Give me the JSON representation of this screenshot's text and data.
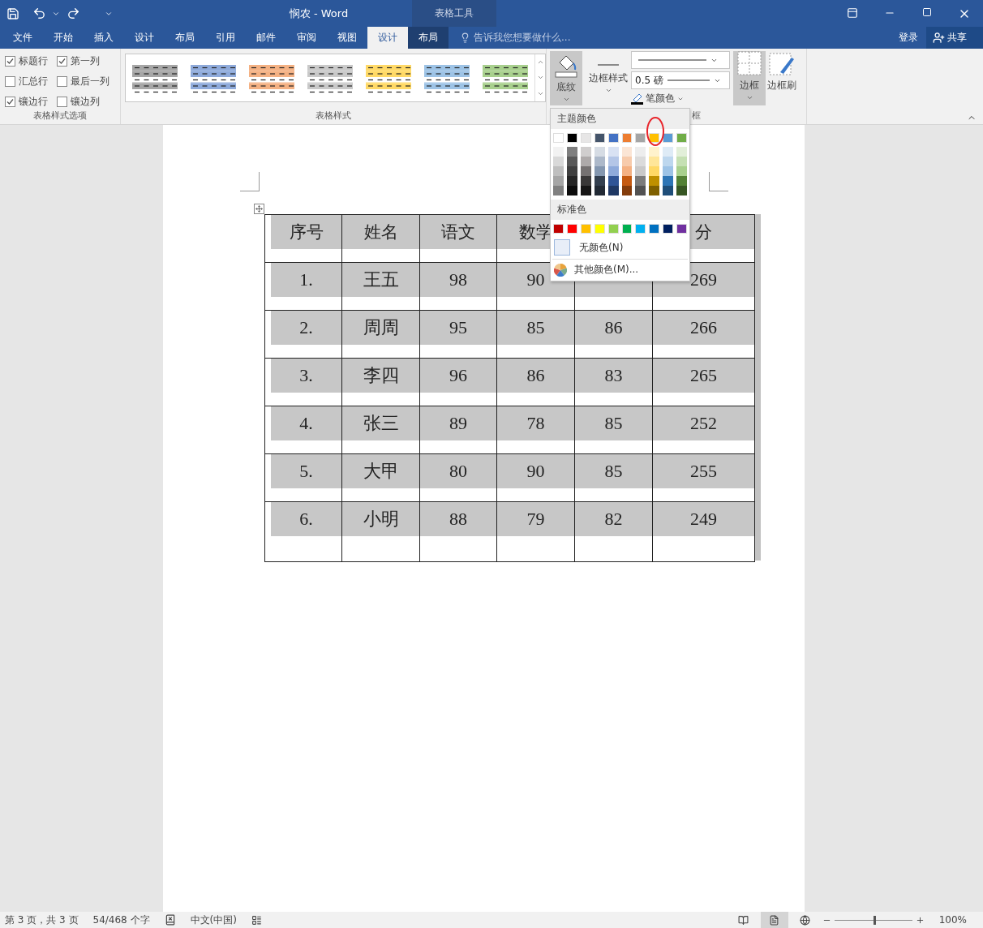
{
  "window": {
    "title": "悯农 - Word",
    "context_header": "表格工具"
  },
  "tabs": [
    {
      "label": "文件",
      "selected": false,
      "contextual": false
    },
    {
      "label": "开始",
      "selected": false,
      "contextual": false
    },
    {
      "label": "插入",
      "selected": false,
      "contextual": false
    },
    {
      "label": "设计",
      "selected": false,
      "contextual": false
    },
    {
      "label": "布局",
      "selected": false,
      "contextual": false
    },
    {
      "label": "引用",
      "selected": false,
      "contextual": false
    },
    {
      "label": "邮件",
      "selected": false,
      "contextual": false
    },
    {
      "label": "审阅",
      "selected": false,
      "contextual": false
    },
    {
      "label": "视图",
      "selected": false,
      "contextual": false
    },
    {
      "label": "设计",
      "selected": true,
      "contextual": true
    },
    {
      "label": "布局",
      "selected": false,
      "contextual": true
    }
  ],
  "tell_me": {
    "placeholder": "告诉我您想要做什么..."
  },
  "sign_in": "登录",
  "share": "共享",
  "style_options": {
    "label": "表格样式选项",
    "items": [
      {
        "label": "标题行",
        "checked": true
      },
      {
        "label": "第一列",
        "checked": true
      },
      {
        "label": "汇总行",
        "checked": false
      },
      {
        "label": "最后一列",
        "checked": false
      },
      {
        "label": "镶边行",
        "checked": true
      },
      {
        "label": "镶边列",
        "checked": false
      }
    ]
  },
  "table_styles": {
    "label": "表格样式",
    "items": [
      {
        "color": "#a6a6a6"
      },
      {
        "color": "#8eaadb"
      },
      {
        "color": "#f4b183"
      },
      {
        "color": "#c9c9c9"
      },
      {
        "color": "#ffd966"
      },
      {
        "color": "#9dc3e6"
      },
      {
        "color": "#a8d08d"
      }
    ]
  },
  "borders": {
    "label": "框",
    "shading": {
      "label": "底纹",
      "expanded": true
    },
    "border_styles": "边框样式",
    "pen_weight": "0.5 磅",
    "pen_color": "笔颜色",
    "borders_button": {
      "label": "边框",
      "pressed": true
    },
    "border_painter": "边框刷"
  },
  "shading_menu": {
    "theme_heading": "主题颜色",
    "theme_colors": [
      {
        "color": "#ffffff",
        "selected": false,
        "shades": [
          {
            "color": "#f2f2f2"
          },
          {
            "color": "#d9d9d9"
          },
          {
            "color": "#bfbfbf"
          },
          {
            "color": "#a6a6a6"
          },
          {
            "color": "#808080"
          }
        ]
      },
      {
        "color": "#000000",
        "selected": false,
        "shades": [
          {
            "color": "#7f7f7f"
          },
          {
            "color": "#595959"
          },
          {
            "color": "#404040"
          },
          {
            "color": "#262626"
          },
          {
            "color": "#0d0d0d"
          }
        ]
      },
      {
        "color": "#e7e6e6",
        "selected": false,
        "shades": [
          {
            "color": "#d0cece"
          },
          {
            "color": "#aeaaaa"
          },
          {
            "color": "#757171"
          },
          {
            "color": "#3a3838"
          },
          {
            "color": "#171616"
          }
        ]
      },
      {
        "color": "#44546a",
        "selected": false,
        "shades": [
          {
            "color": "#d6dce4"
          },
          {
            "color": "#adb9ca"
          },
          {
            "color": "#8497b0"
          },
          {
            "color": "#333f4f"
          },
          {
            "color": "#222a35"
          }
        ]
      },
      {
        "color": "#4472c4",
        "selected": false,
        "shades": [
          {
            "color": "#d9e2f3"
          },
          {
            "color": "#b4c6e7"
          },
          {
            "color": "#8eaadb"
          },
          {
            "color": "#2f5496"
          },
          {
            "color": "#1f3864"
          }
        ]
      },
      {
        "color": "#ed7d31",
        "selected": false,
        "shades": [
          {
            "color": "#fbe5d5"
          },
          {
            "color": "#f7cbac"
          },
          {
            "color": "#f4b183"
          },
          {
            "color": "#c55a11"
          },
          {
            "color": "#843c0b"
          }
        ]
      },
      {
        "color": "#a5a5a5",
        "selected": false,
        "shades": [
          {
            "color": "#ededed"
          },
          {
            "color": "#dbdbdb"
          },
          {
            "color": "#c9c9c9"
          },
          {
            "color": "#7b7b7b"
          },
          {
            "color": "#525252"
          }
        ]
      },
      {
        "color": "#ffc000",
        "selected": true,
        "shades": [
          {
            "color": "#fff2cc"
          },
          {
            "color": "#ffe699"
          },
          {
            "color": "#ffd966"
          },
          {
            "color": "#bf9000"
          },
          {
            "color": "#7f6000"
          }
        ]
      },
      {
        "color": "#5b9bd5",
        "selected": false,
        "shades": [
          {
            "color": "#deebf6"
          },
          {
            "color": "#bdd7ee"
          },
          {
            "color": "#9dc3e6"
          },
          {
            "color": "#2e75b5"
          },
          {
            "color": "#1f4e79"
          }
        ]
      },
      {
        "color": "#70ad47",
        "selected": false,
        "shades": [
          {
            "color": "#e2efd9"
          },
          {
            "color": "#c5e0b3"
          },
          {
            "color": "#a8d08d"
          },
          {
            "color": "#538135"
          },
          {
            "color": "#375623"
          }
        ]
      }
    ],
    "standard_heading": "标准色",
    "standard_colors": [
      {
        "color": "#c00000"
      },
      {
        "color": "#ff0000"
      },
      {
        "color": "#ffc000"
      },
      {
        "color": "#ffff00"
      },
      {
        "color": "#92d050"
      },
      {
        "color": "#00b050"
      },
      {
        "color": "#00b0f0"
      },
      {
        "color": "#0070c0"
      },
      {
        "color": "#002060"
      },
      {
        "color": "#7030a0"
      }
    ],
    "no_color": "无颜色(N)",
    "more_colors": "其他颜色(M)..."
  },
  "table": {
    "header": {
      "no": "序号",
      "name": "姓名",
      "chinese": "语文",
      "math": "数学",
      "total": "分"
    },
    "rows": [
      {
        "no": "1.",
        "name": "王五",
        "chinese": "98",
        "math": "90",
        "total": "269"
      },
      {
        "no": "2.",
        "name": "周周",
        "chinese": "95",
        "math": "85",
        "column_5": "86",
        "total": "266"
      },
      {
        "no": "3.",
        "name": "李四",
        "chinese": "96",
        "math": "86",
        "column_5": "83",
        "total": "265"
      },
      {
        "no": "4.",
        "name": "张三",
        "chinese": "89",
        "math": "78",
        "column_5": "85",
        "total": "252"
      },
      {
        "no": "5.",
        "name": "大甲",
        "chinese": "80",
        "math": "90",
        "column_5": "85",
        "total": "255"
      },
      {
        "no": "6.",
        "name": "小明",
        "chinese": "88",
        "math": "79",
        "column_5": "82",
        "total": "249"
      }
    ]
  },
  "status_bar": {
    "page": "第 3 页，共 3 页",
    "words": "54/468 个字",
    "language": "中文(中国)",
    "views": [
      {
        "kind": "read",
        "selected": false
      },
      {
        "kind": "print",
        "selected": true
      },
      {
        "kind": "web",
        "selected": false
      }
    ],
    "zoom": {
      "level": 0.5,
      "reading": "100%"
    }
  }
}
